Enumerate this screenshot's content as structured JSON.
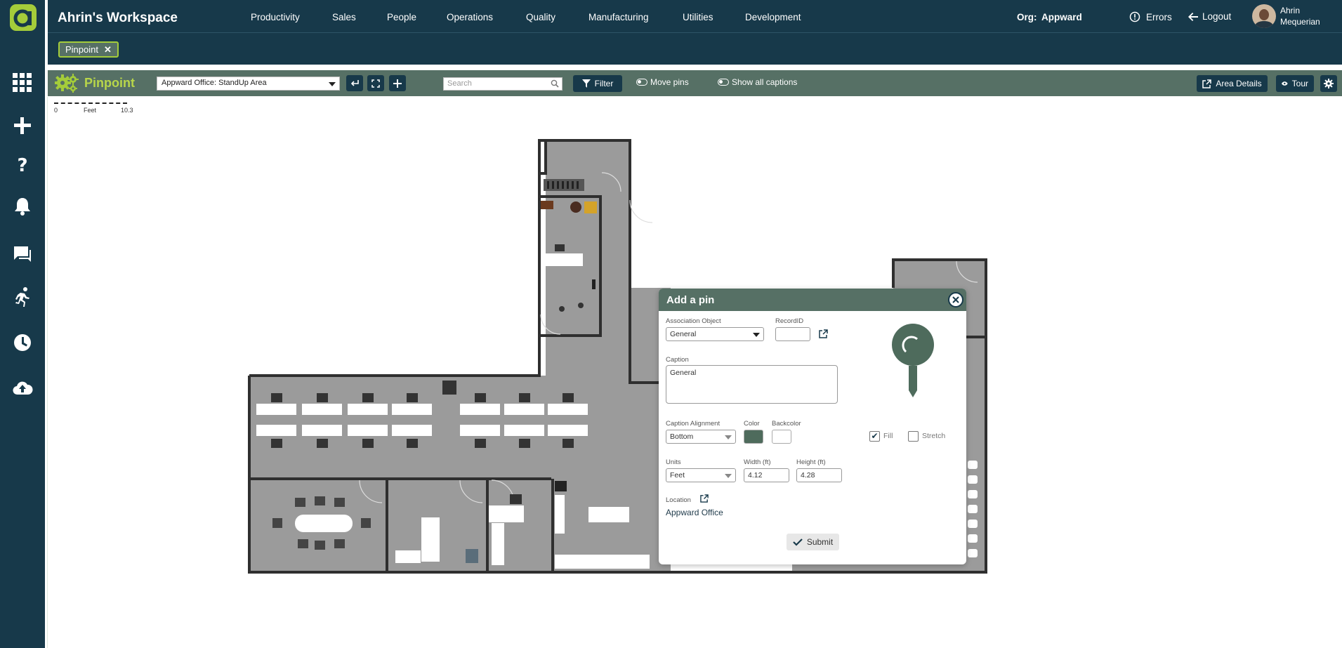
{
  "header": {
    "workspace_title": "Ahrin's Workspace",
    "nav": [
      "Productivity",
      "Sales",
      "People",
      "Operations",
      "Quality",
      "Manufacturing",
      "Utilities",
      "Development"
    ],
    "org_label": "Org:",
    "org_value": "Appward",
    "errors_label": "Errors",
    "logout_label": "Logout",
    "user_first": "Ahrin",
    "user_last": "Mequerian"
  },
  "open_tabs": [
    {
      "label": "Pinpoint",
      "close": "✕"
    }
  ],
  "toolbar": {
    "app_title": "Pinpoint",
    "area_select": "Appward Office: StandUp Area",
    "search_placeholder": "Search",
    "filter_label": "Filter",
    "move_pins_label": "Move pins",
    "show_captions_label": "Show all captions",
    "area_details_label": "Area Details",
    "tour_label": "Tour"
  },
  "scale": {
    "min": "0",
    "unit": "Feet",
    "max": "10.3"
  },
  "dialog": {
    "title": "Add a pin",
    "association_object_label": "Association Object",
    "association_object_value": "General",
    "record_id_label": "RecordID",
    "record_id_value": "",
    "caption_label": "Caption",
    "caption_value": "General",
    "caption_alignment_label": "Caption Alignment",
    "caption_alignment_value": "Bottom",
    "color_label": "Color",
    "color_value": "#4e6b5c",
    "backcolor_label": "Backcolor",
    "backcolor_value": "#ffffff",
    "fill_label": "Fill",
    "fill_checked": true,
    "stretch_label": "Stretch",
    "stretch_checked": false,
    "units_label": "Units",
    "units_value": "Feet",
    "width_label": "Width (ft)",
    "width_value": "4.12",
    "height_label": "Height (ft)",
    "height_value": "4.28",
    "location_label": "Location",
    "location_value": "Appward Office",
    "submit_label": "Submit"
  },
  "colors": {
    "navy": "#17394a",
    "toolbar_green": "#567065",
    "accent_lime": "#a4cc3a",
    "floor_grey": "#9b9b9b",
    "wall": "#2f2f2f"
  }
}
